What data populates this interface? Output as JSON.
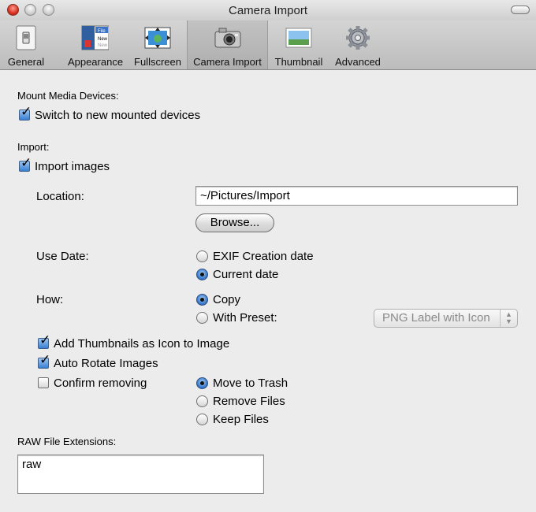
{
  "window": {
    "title": "Camera Import"
  },
  "toolbar": {
    "items": [
      {
        "label": "General",
        "icon": "switch-icon"
      },
      {
        "label": "Appearance",
        "icon": "appearance-icon"
      },
      {
        "label": "Fullscreen",
        "icon": "fullscreen-icon"
      },
      {
        "label": "Camera Import",
        "icon": "camera-icon",
        "selected": true
      },
      {
        "label": "Thumbnail",
        "icon": "thumbnail-icon"
      },
      {
        "label": "Advanced",
        "icon": "gear-icon"
      }
    ],
    "appearance_icon_lines": [
      "File",
      "New",
      "New"
    ]
  },
  "mount": {
    "section_label": "Mount Media Devices:",
    "switch_label": "Switch to new mounted devices",
    "switch_checked": true
  },
  "import": {
    "section_label": "Import:",
    "import_images_label": "Import images",
    "import_images_checked": true,
    "location_label": "Location:",
    "location_value": "~/Pictures/Import",
    "browse_label": "Browse...",
    "use_date_label": "Use Date:",
    "date_options": [
      {
        "label": "EXIF Creation date",
        "selected": false
      },
      {
        "label": "Current date",
        "selected": true
      }
    ],
    "how_label": "How:",
    "how_options": [
      {
        "label": "Copy",
        "selected": true
      },
      {
        "label": "With Preset:",
        "selected": false
      }
    ],
    "preset_value": "PNG Label with Icon",
    "add_thumbnails_label": "Add Thumbnails as Icon to Image",
    "add_thumbnails_checked": true,
    "auto_rotate_label": "Auto Rotate Images",
    "auto_rotate_checked": true,
    "confirm_removing_label": "Confirm removing",
    "confirm_removing_checked": false,
    "remove_options": [
      {
        "label": "Move to Trash",
        "selected": true
      },
      {
        "label": "Remove Files",
        "selected": false
      },
      {
        "label": "Keep Files",
        "selected": false
      }
    ]
  },
  "raw": {
    "section_label": "RAW File Extensions:",
    "value": "raw"
  },
  "colors": {
    "accent": "#3a7fd3",
    "close": "#d6301f"
  }
}
